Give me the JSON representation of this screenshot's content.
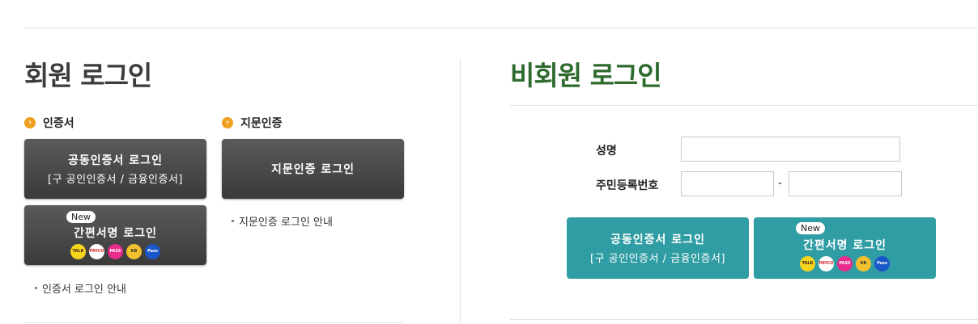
{
  "member": {
    "title": "회원 로그인",
    "cert": {
      "label": "인증서",
      "button_main": "공동인증서 로그인",
      "button_sub": "[구 공인인증서 / 금융인증서]",
      "guide": "인증서 로그인 안내"
    },
    "fingerprint": {
      "label": "지문인증",
      "button_main": "지문인증 로그인",
      "guide": "지문인증 로그인 안내"
    },
    "simple_sign": {
      "badge": "New",
      "button_main": "간편서명 로그인"
    }
  },
  "guest": {
    "title": "비회원 로그인",
    "name_label": "성명",
    "rrn_label": "주민등록번호",
    "rrn_separator": "-",
    "name_value": "",
    "rrn_front_value": "",
    "rrn_back_value": "",
    "cert_button_main": "공동인증서 로그인",
    "cert_button_sub": "[구 공인인증서 / 금융인증서]",
    "simple_badge": "New",
    "simple_button_main": "간편서명 로그인"
  },
  "app_icons": [
    {
      "name": "kakao-talk-icon",
      "text": "TALK",
      "bg": "#f7d51d",
      "fg": "#3a1d1d"
    },
    {
      "name": "payco-icon",
      "text": "PAYCO",
      "bg": "#ffffff",
      "fg": "#e0262b"
    },
    {
      "name": "pass-icon",
      "text": "PASS",
      "bg": "#e72c8b",
      "fg": "#ffffff"
    },
    {
      "name": "kb-icon",
      "text": "KB",
      "bg": "#f3c12e",
      "fg": "#333333"
    },
    {
      "name": "samsung-pass-icon",
      "text": "Pass",
      "bg": "#1a57c9",
      "fg": "#ffffff"
    }
  ],
  "colors": {
    "guest_title": "#2f6b2f",
    "teal_button": "#2f9da3",
    "dark_button": "#444444",
    "bullet": "#f0a020"
  }
}
